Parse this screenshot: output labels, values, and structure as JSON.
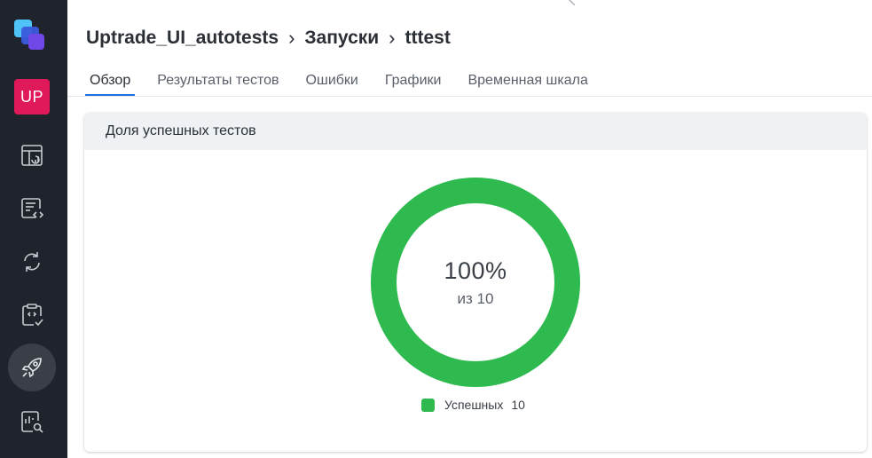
{
  "sidebar": {
    "project_badge": "UP",
    "icons": [
      "dashboard-icon",
      "test-cases-icon",
      "sync-icon",
      "checklist-icon",
      "launches-icon",
      "reports-search-icon"
    ]
  },
  "breadcrumb": {
    "project": "Uptrade_UI_autotests",
    "section": "Запуски",
    "launch": "tttest"
  },
  "tabs": [
    {
      "label": "Обзор",
      "active": true
    },
    {
      "label": "Результаты тестов",
      "active": false
    },
    {
      "label": "Ошибки",
      "active": false
    },
    {
      "label": "Графики",
      "active": false
    },
    {
      "label": "Временная шкала",
      "active": false
    }
  ],
  "card": {
    "title": "Доля успешных тестов",
    "percent_text": "100%",
    "total_text": "из 10"
  },
  "chart_data": {
    "type": "pie",
    "categories": [
      "Успешных"
    ],
    "values": [
      10
    ],
    "colors": [
      "#2fba4f"
    ]
  },
  "legend": {
    "label": "Успешных",
    "count": "10"
  },
  "colors": {
    "sidebar_bg": "#1f232b",
    "badge": "#e0195a",
    "success": "#2fba4f",
    "tab_accent": "#1b6fe0"
  }
}
